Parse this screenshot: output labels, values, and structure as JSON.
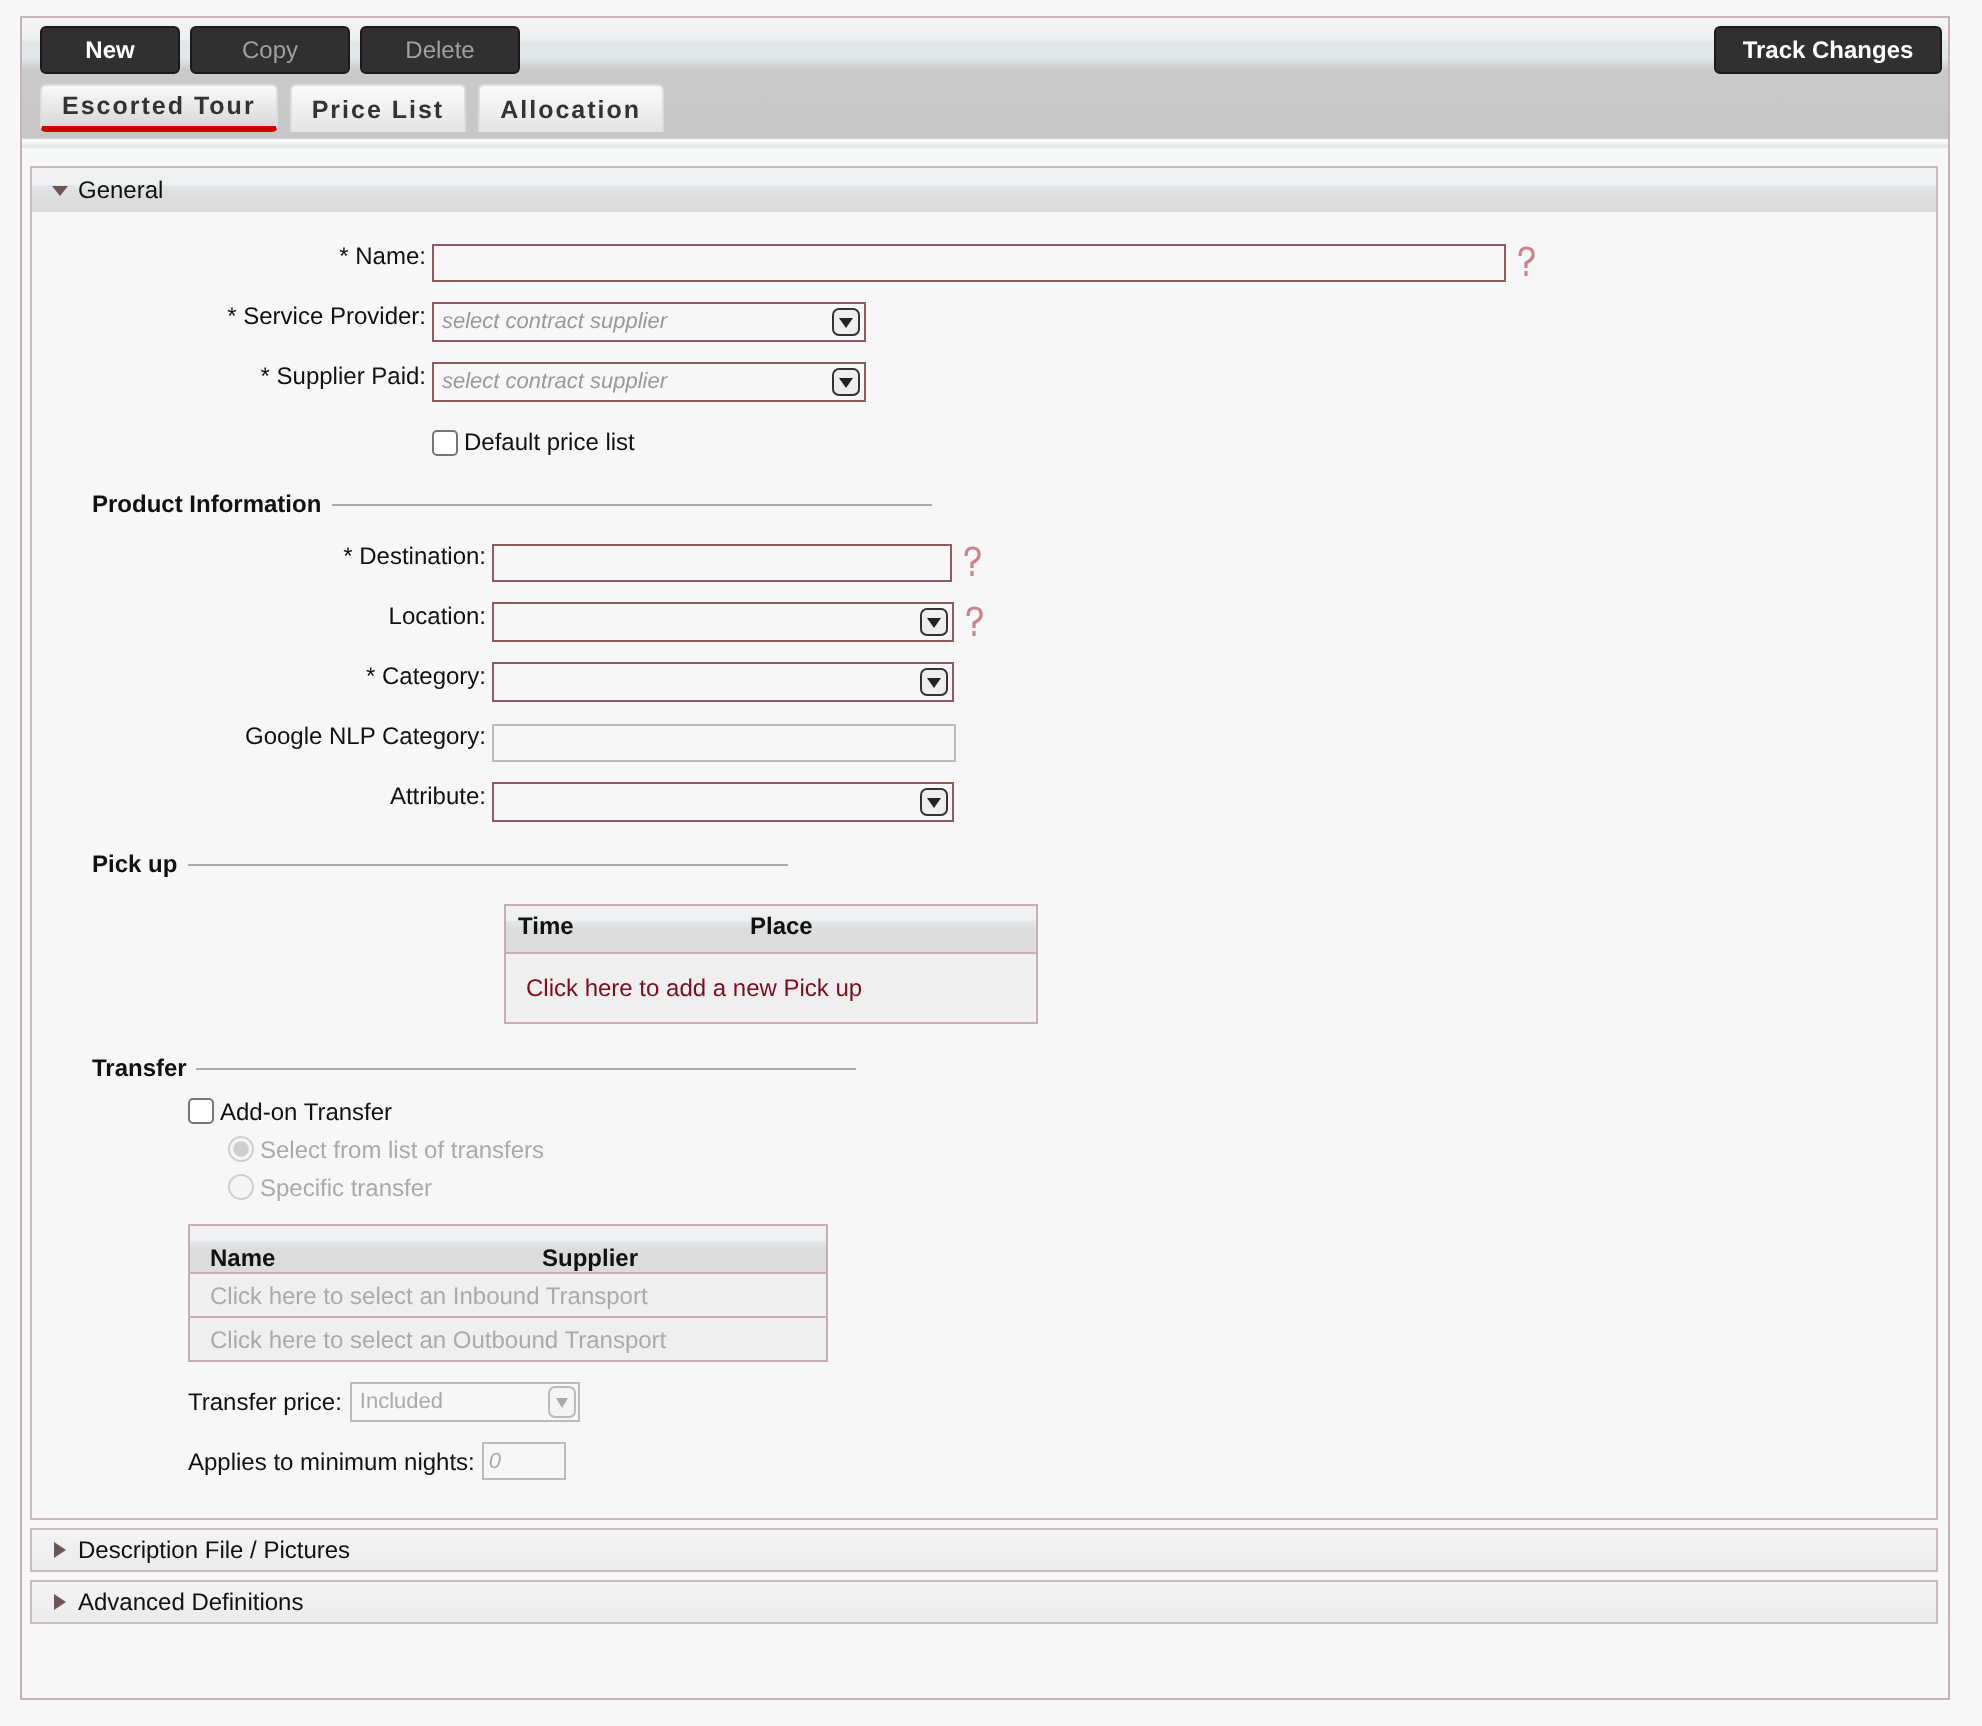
{
  "toolbar": {
    "buttons": [
      {
        "label": "New",
        "disabled": false
      },
      {
        "label": "Copy",
        "disabled": true
      },
      {
        "label": "Delete",
        "disabled": true
      }
    ],
    "track_changes": "Track Changes"
  },
  "tabs": [
    {
      "label": "Escorted Tour",
      "selected": true
    },
    {
      "label": "Price List",
      "selected": false
    },
    {
      "label": "Allocation",
      "selected": false
    }
  ],
  "general": {
    "title": "General",
    "expanded": true,
    "fields": [
      {
        "kind": "text",
        "label": "* Name:",
        "help": true,
        "wide": true
      },
      {
        "kind": "select",
        "label": "* Service Provider:",
        "placeholder": "select contract supplier",
        "help": false
      },
      {
        "kind": "select",
        "label": "* Supplier Paid:",
        "placeholder": "select contract supplier",
        "help": false
      },
      {
        "kind": "checkbox",
        "label": "Default price list",
        "checked": false
      }
    ],
    "product_information": {
      "heading": "Product Information",
      "fields": [
        {
          "kind": "text",
          "label": "* Destination:",
          "help": true,
          "disabled": false
        },
        {
          "kind": "select",
          "label": "Location:",
          "help": true
        },
        {
          "kind": "select",
          "label": "* Category:",
          "help": false
        },
        {
          "kind": "text",
          "label": "Google NLP Category:",
          "help": false,
          "disabled": true
        },
        {
          "kind": "select",
          "label": "Attribute:",
          "help": false
        }
      ]
    },
    "pick_up": {
      "heading": "Pick up",
      "columns": [
        "Time",
        "Place"
      ],
      "add_link": "Click here to add a new Pick up"
    },
    "transfer": {
      "heading": "Transfer",
      "add_on": {
        "label": "Add-on Transfer",
        "checked": false
      },
      "options": [
        {
          "label": "Select from list of transfers",
          "selected": true,
          "disabled": true
        },
        {
          "label": "Specific transfer",
          "selected": false,
          "disabled": true
        }
      ],
      "columns": [
        "Name",
        "Supplier"
      ],
      "rows": [
        "Click here to select an Inbound Transport",
        "Click here to select an Outbound Transport"
      ],
      "price": {
        "label": "Transfer price:",
        "value": "Included",
        "disabled": true
      },
      "min_nights": {
        "label": "Applies to minimum nights:",
        "placeholder": "0"
      }
    }
  },
  "sections": [
    {
      "title": "Description File / Pictures",
      "expanded": false
    },
    {
      "title": "Advanced Definitions",
      "expanded": false
    }
  ]
}
